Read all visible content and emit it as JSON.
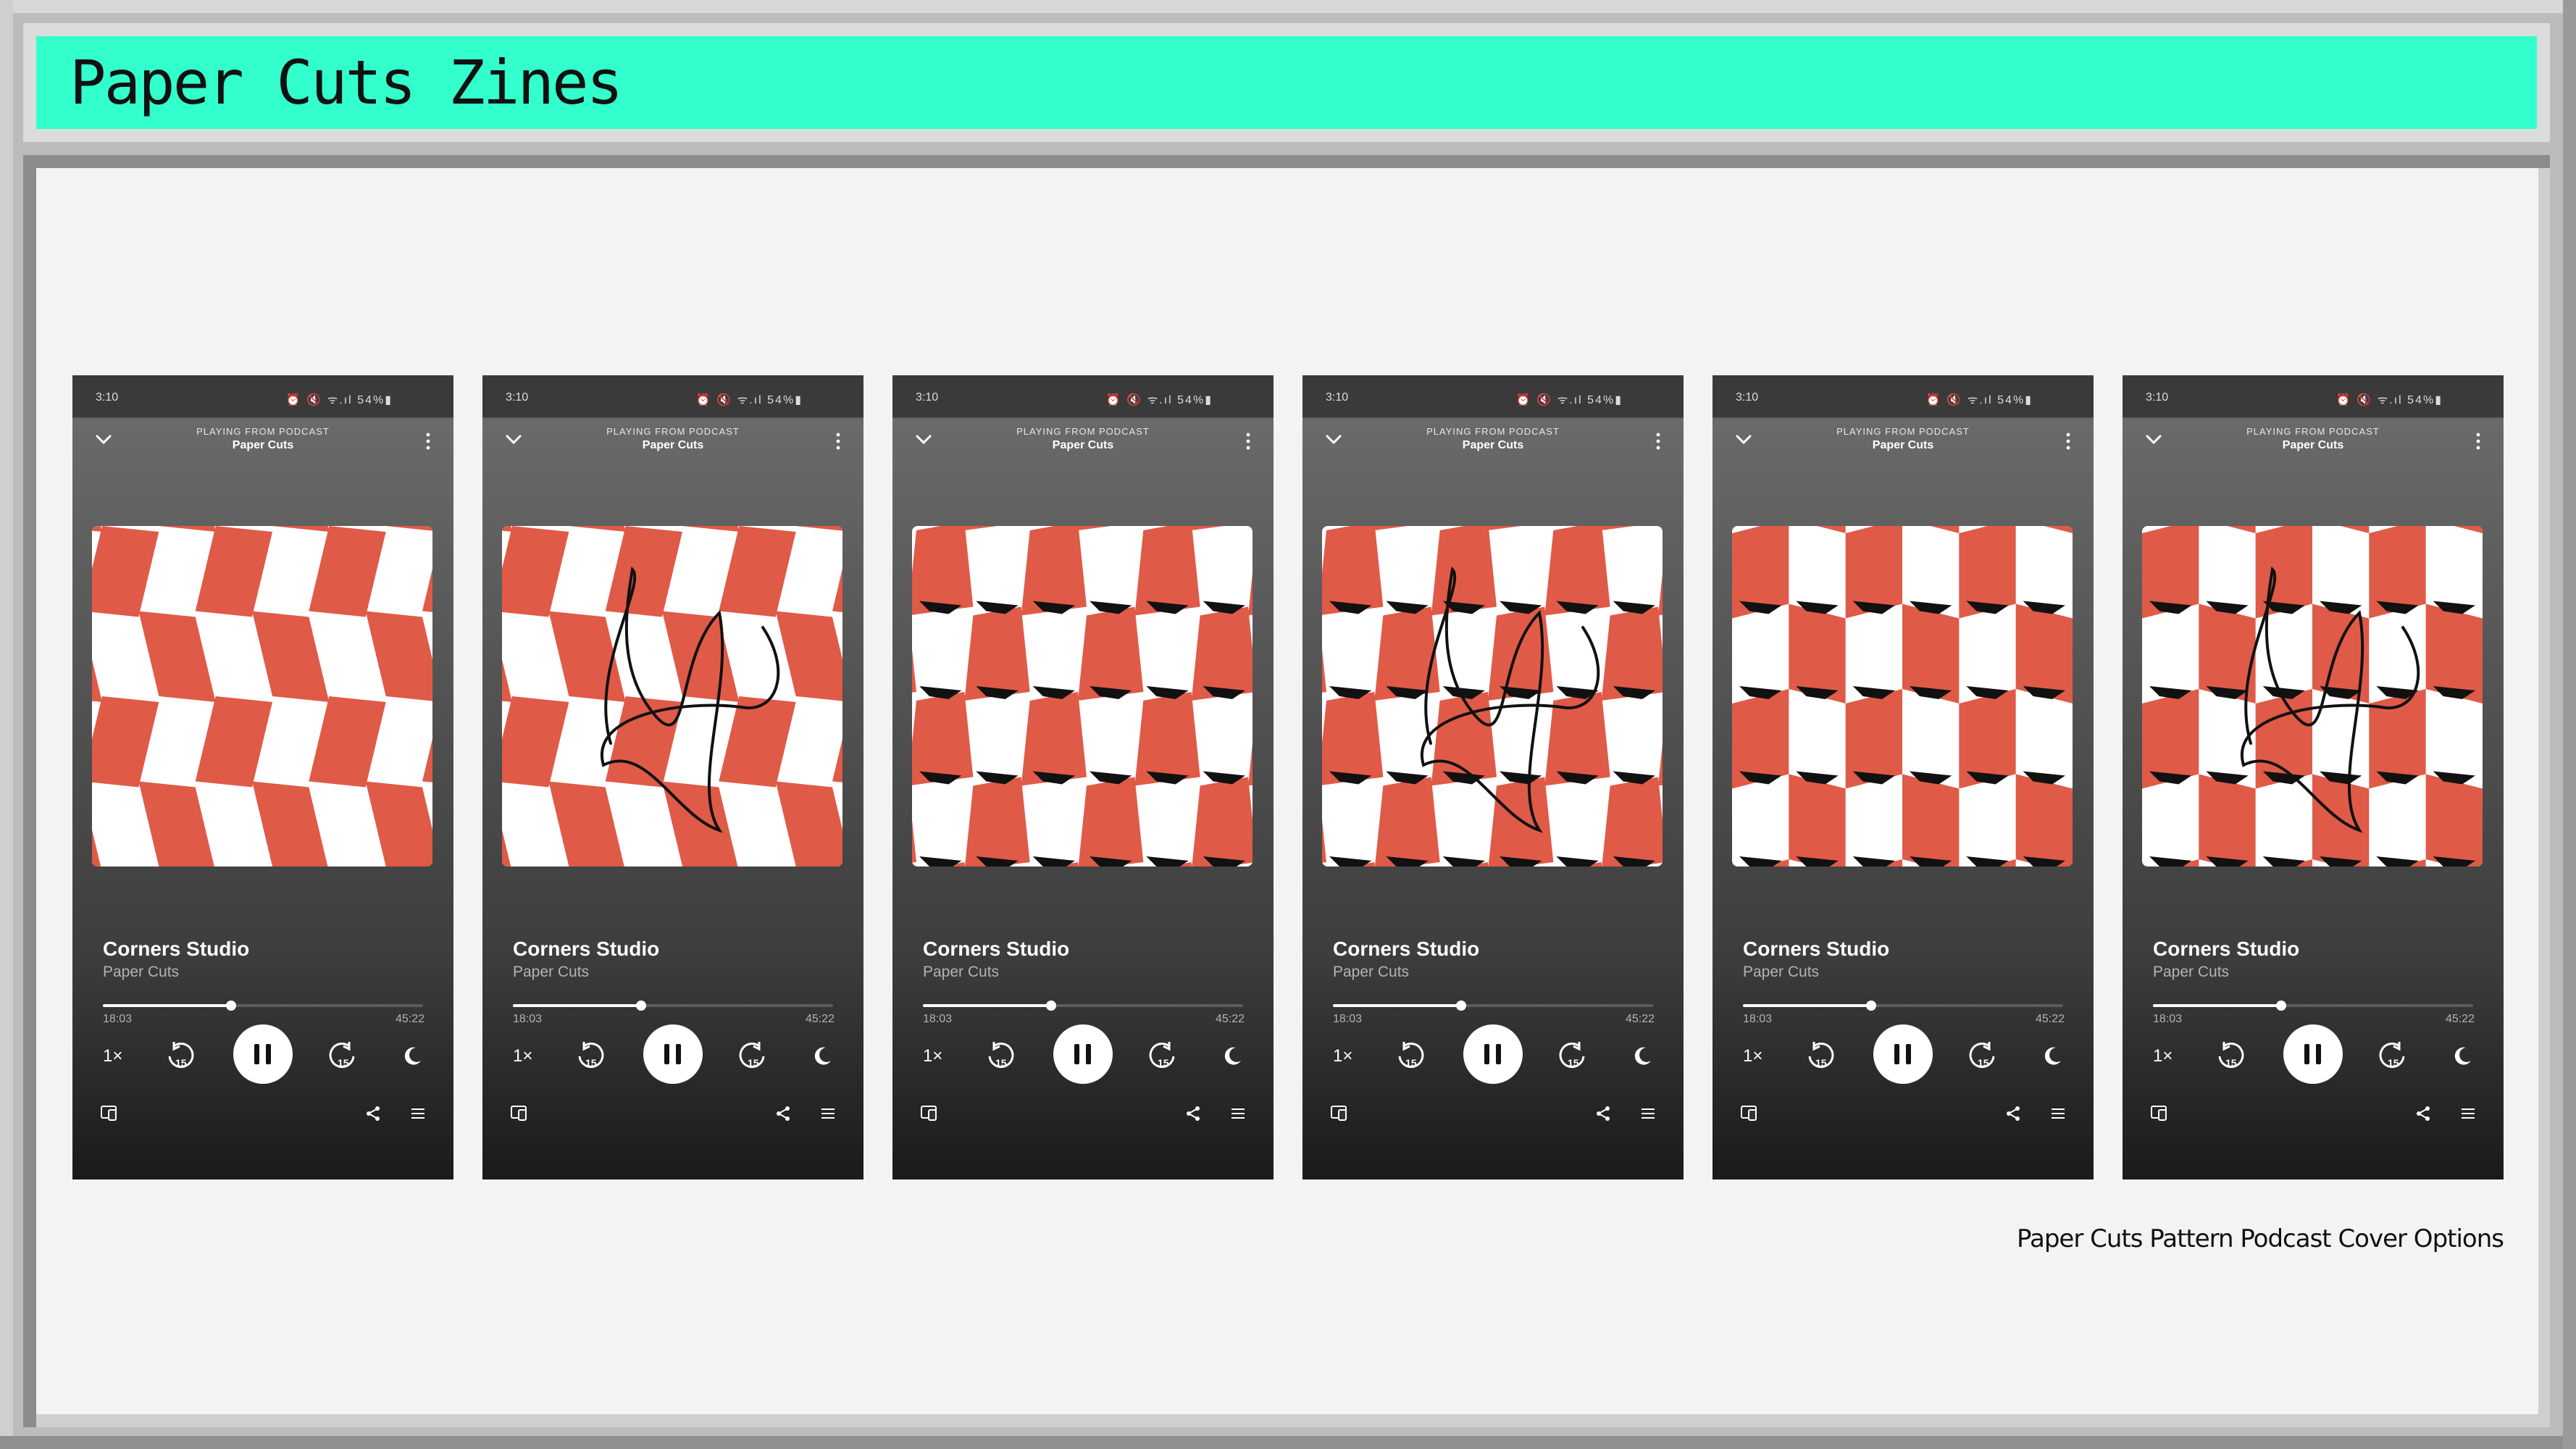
{
  "app": {
    "title": "Paper Cuts Zines"
  },
  "caption": "Paper Cuts Pattern Podcast Cover Options",
  "phone": {
    "status_time": "3:10",
    "status_icons": "⏰ 🔇 ᯤ.ıl",
    "battery": "54%▮",
    "playing_from": "PLAYING FROM PODCAST",
    "podcast_name": "Paper Cuts",
    "episode_title": "Corners Studio",
    "episode_subtitle": "Paper Cuts",
    "elapsed": "18:03",
    "duration": "45:22",
    "progress_fraction": 0.4,
    "speed": "1×",
    "skip_back_seconds": "15",
    "skip_forward_seconds": "15"
  },
  "covers": [
    {
      "pattern": "skewed-checker",
      "scribble": false
    },
    {
      "pattern": "skewed-checker",
      "scribble": true
    },
    {
      "pattern": "block-checker",
      "scribble": false
    },
    {
      "pattern": "block-checker",
      "scribble": true
    },
    {
      "pattern": "wave-checker",
      "scribble": false
    },
    {
      "pattern": "wave-checker",
      "scribble": true
    }
  ],
  "colors": {
    "accent": "#33ffcc",
    "cover_red": "#e05a48",
    "cover_white": "#ffffff",
    "ink": "#111111"
  }
}
